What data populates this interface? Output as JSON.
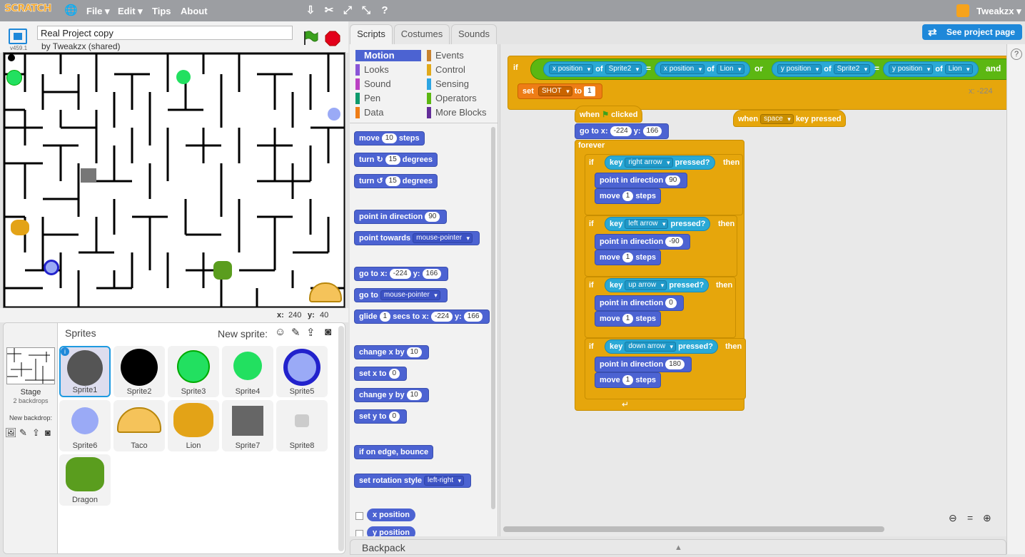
{
  "menubar": {
    "logo": "SCRATCH",
    "file": "File ▾",
    "edit": "Edit ▾",
    "tips": "Tips",
    "about": "About",
    "user": "Tweakzx ▾"
  },
  "project": {
    "title": "Real Project copy",
    "byline": "by Tweakzx (shared)",
    "version": "v459.1",
    "see_project_page": "See project page"
  },
  "stage_coords": {
    "x_label": "x:",
    "x_value": "240",
    "y_label": "y:",
    "y_value": "40"
  },
  "sprites_header": {
    "title": "Sprites",
    "new_sprite": "New sprite:"
  },
  "stage_info": {
    "label": "Stage",
    "backdrops": "2 backdrops",
    "new_backdrop": "New backdrop:"
  },
  "sprites": [
    {
      "name": "Sprite1"
    },
    {
      "name": "Sprite2"
    },
    {
      "name": "Sprite3"
    },
    {
      "name": "Sprite4"
    },
    {
      "name": "Sprite5"
    },
    {
      "name": "Sprite6"
    },
    {
      "name": "Taco"
    },
    {
      "name": "Lion"
    },
    {
      "name": "Sprite7"
    },
    {
      "name": "Sprite8"
    },
    {
      "name": "Dragon"
    }
  ],
  "tabs": {
    "scripts": "Scripts",
    "costumes": "Costumes",
    "sounds": "Sounds"
  },
  "categories": {
    "motion": "Motion",
    "looks": "Looks",
    "sound": "Sound",
    "pen": "Pen",
    "data": "Data",
    "events": "Events",
    "control": "Control",
    "sensing": "Sensing",
    "operators": "Operators",
    "more": "More Blocks",
    "colors": {
      "motion": "#4c63d2",
      "looks": "#8a55d7",
      "sound": "#bb42c3",
      "pen": "#0e9a6c",
      "data": "#ee7d16",
      "events": "#c88330",
      "control": "#e1a91a",
      "sensing": "#2ca5e2",
      "operators": "#5cb712",
      "more": "#632d99"
    }
  },
  "palette": {
    "move": "move",
    "move_n": "10",
    "steps": "steps",
    "turn": "turn",
    "turn_n": "15",
    "degrees": "degrees",
    "turn2_n": "15",
    "point_dir": "point in direction",
    "point_dir_v": "90",
    "point_towards": "point towards",
    "point_towards_v": "mouse-pointer",
    "goto": "go to x:",
    "goto_x": "-224",
    "y": "y:",
    "goto_y": "166",
    "goto2": "go to",
    "goto2_v": "mouse-pointer",
    "glide": "glide",
    "glide_n": "1",
    "secs_to_x": "secs to x:",
    "glide_x": "-224",
    "glide_y": "166",
    "change_x": "change x by",
    "change_x_v": "10",
    "set_x": "set x to",
    "set_x_v": "0",
    "change_y": "change y by",
    "change_y_v": "10",
    "set_y": "set y to",
    "set_y_v": "0",
    "edge": "if on edge, bounce",
    "rot": "set rotation style",
    "rot_v": "left-right",
    "xpos": "x position",
    "ypos": "y position"
  },
  "script": {
    "if": "if",
    "xpos": "x position",
    "of": "of",
    "sprite2": "Sprite2",
    "lion": "Lion",
    "ypos": "y position",
    "or": "or",
    "and": "and",
    "eq": "=",
    "set": "set",
    "shot": "SHOT",
    "to": "to",
    "one": "1",
    "coord_x": "x: -224",
    "when": "when",
    "clicked": "clicked",
    "goto": "go to x:",
    "gx": "-224",
    "y": "y:",
    "gy": "166",
    "forever": "forever",
    "key": "key",
    "pressed": "pressed?",
    "then": "then",
    "right": "right arrow",
    "left": "left arrow",
    "up": "up arrow",
    "down": "down arrow",
    "point": "point in direction",
    "d90": "90",
    "dm90": "-90",
    "d0": "0",
    "d180": "180",
    "move": "move",
    "steps": "steps",
    "move_n": "1",
    "space": "space",
    "key_pressed": "key pressed"
  },
  "backpack": "Backpack"
}
